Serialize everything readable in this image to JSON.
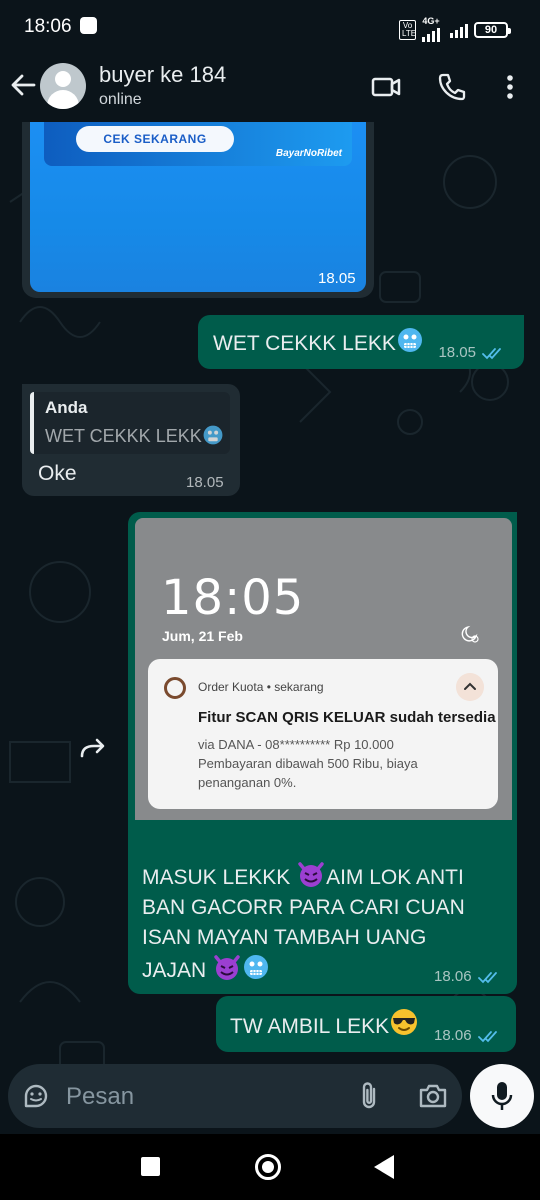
{
  "status_bar": {
    "time": "18:06",
    "volte": "Vo LTE",
    "network": "4G+",
    "battery": "90"
  },
  "header": {
    "contact_name": "buyer ke 184",
    "contact_status": "online",
    "icons": [
      "back-arrow-icon",
      "video-call-icon",
      "voice-call-icon",
      "more-options-icon"
    ]
  },
  "messages": [
    {
      "id": "m1",
      "direction": "incoming",
      "type": "image",
      "banner_button": "CEK SEKARANG",
      "banner_brand": "BayarNoRibet",
      "time": "18.05"
    },
    {
      "id": "m2",
      "direction": "outgoing",
      "text": "WET CEKKK LEKK",
      "emoji": "cold-face",
      "time": "18.05",
      "status": "read"
    },
    {
      "id": "m3",
      "direction": "incoming",
      "reply_author": "Anda",
      "reply_text": "WET CEKKK LEKK",
      "reply_emoji": "cold-face",
      "text": "Oke",
      "time": "18.05"
    },
    {
      "id": "m4",
      "direction": "outgoing",
      "type": "image_with_caption",
      "screenshot": {
        "lock_time": "18:05",
        "lock_date": "Jum, 21 Feb",
        "notification": {
          "app": "Order Kuota",
          "when": "sekarang",
          "app_line": "Order Kuota • sekarang",
          "title": "Fitur SCAN QRIS KELUAR sudah tersedia",
          "body_line1": "via DANA - 08********** Rp 10.000",
          "body_line2": "Pembayaran dibawah 500 Ribu, biaya",
          "body_line3": "penanganan 0%."
        }
      },
      "caption_line1": "MASUK LEKKK",
      "caption_line1b": "AIM LOK ANTI",
      "caption_line2": "BAN GACORR PARA CARI CUAN",
      "caption_line3": "ISAN MAYAN TAMBAH UANG",
      "caption_line4": "JAJAN",
      "time": "18.06",
      "status": "read"
    },
    {
      "id": "m5",
      "direction": "outgoing",
      "text": "TW AMBIL LEKK",
      "emoji": "sunglasses-face",
      "time": "18.06",
      "status": "read"
    }
  ],
  "composer": {
    "placeholder": "Pesan",
    "icons": [
      "sticker-icon",
      "attach-icon",
      "camera-icon",
      "mic-icon"
    ]
  },
  "colors": {
    "background": "#0b141a",
    "incoming_bubble": "#202c33",
    "outgoing_bubble": "#005c4b",
    "read_ticks": "#53bdeb"
  }
}
